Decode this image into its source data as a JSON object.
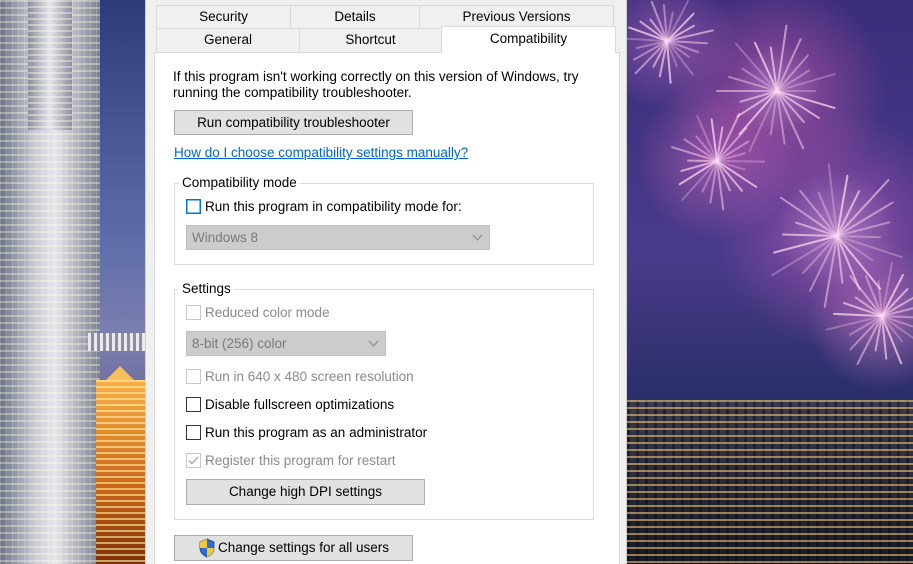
{
  "tabs": {
    "row1": [
      "Security",
      "Details",
      "Previous Versions"
    ],
    "row2": [
      "General",
      "Shortcut"
    ],
    "active": "Compatibility"
  },
  "intro": {
    "line1": "If this program isn't working correctly on this version of Windows, try",
    "line2": "running the compatibility troubleshooter."
  },
  "troubleshooter_button": "Run compatibility troubleshooter",
  "help_link": "How do I choose compatibility settings manually?",
  "compat_mode": {
    "legend": "Compatibility mode",
    "checkbox_label": "Run this program in compatibility mode for:",
    "checked": false,
    "os_select": "Windows 8"
  },
  "settings": {
    "legend": "Settings",
    "reduced_color": {
      "label": "Reduced color mode",
      "checked": false,
      "enabled": false
    },
    "color_select": "8-bit (256) color",
    "res_640": {
      "label": "Run in 640 x 480 screen resolution",
      "checked": false,
      "enabled": false
    },
    "disable_fullscreen": {
      "label": "Disable fullscreen optimizations",
      "checked": false,
      "enabled": true
    },
    "run_as_admin": {
      "label": "Run this program as an administrator",
      "checked": false,
      "enabled": true
    },
    "register_restart": {
      "label": "Register this program for restart",
      "checked": true,
      "enabled": false
    },
    "dpi_button": "Change high DPI settings"
  },
  "all_users_button": "Change settings for all users",
  "icons": {
    "shield": "uac-shield-icon",
    "chevron": "chevron-down-icon",
    "check": "checkmark-icon"
  },
  "colors": {
    "link": "#0066cc",
    "focus": "#0078d7"
  }
}
